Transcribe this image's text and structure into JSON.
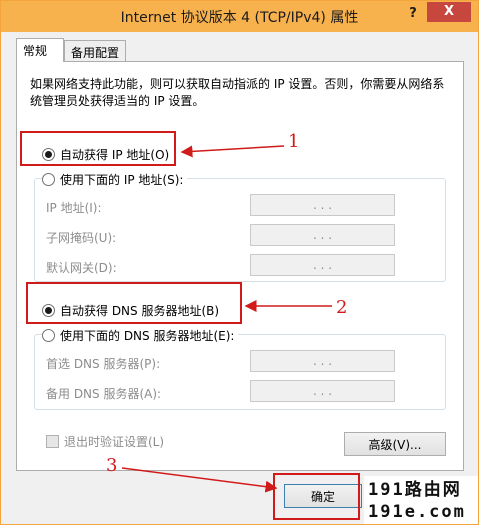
{
  "window": {
    "title": "Internet 协议版本 4 (TCP/IPv4) 属性",
    "help_label": "?",
    "close_label": "X"
  },
  "tabs": [
    {
      "label": "常规",
      "active": true
    },
    {
      "label": "备用配置",
      "active": false
    }
  ],
  "description": "如果网络支持此功能，则可以获取自动指派的 IP 设置。否则，你需要从网络系统管理员处获得适当的 IP 设置。",
  "ip": {
    "auto_label": "自动获得 IP 地址(O)",
    "manual_label": "使用下面的 IP 地址(S):",
    "fields": [
      {
        "label": "IP 地址(I):",
        "value": ". . ."
      },
      {
        "label": "子网掩码(U):",
        "value": ". . ."
      },
      {
        "label": "默认网关(D):",
        "value": ". . ."
      }
    ]
  },
  "dns": {
    "auto_label": "自动获得 DNS 服务器地址(B)",
    "manual_label": "使用下面的 DNS 服务器地址(E):",
    "fields": [
      {
        "label": "首选 DNS 服务器(P):",
        "value": ". . ."
      },
      {
        "label": "备用 DNS 服务器(A):",
        "value": ". . ."
      }
    ]
  },
  "validate_label": "退出时验证设置(L)",
  "advanced_label": "高级(V)...",
  "ok_label": "确定",
  "callouts": [
    "1",
    "2",
    "3"
  ],
  "watermark": {
    "line1": "191路由网",
    "line2": "191e.com"
  },
  "colors": {
    "titlebar": "#f7b24e",
    "close": "#c7463d",
    "annotation": "#d11a1a"
  }
}
